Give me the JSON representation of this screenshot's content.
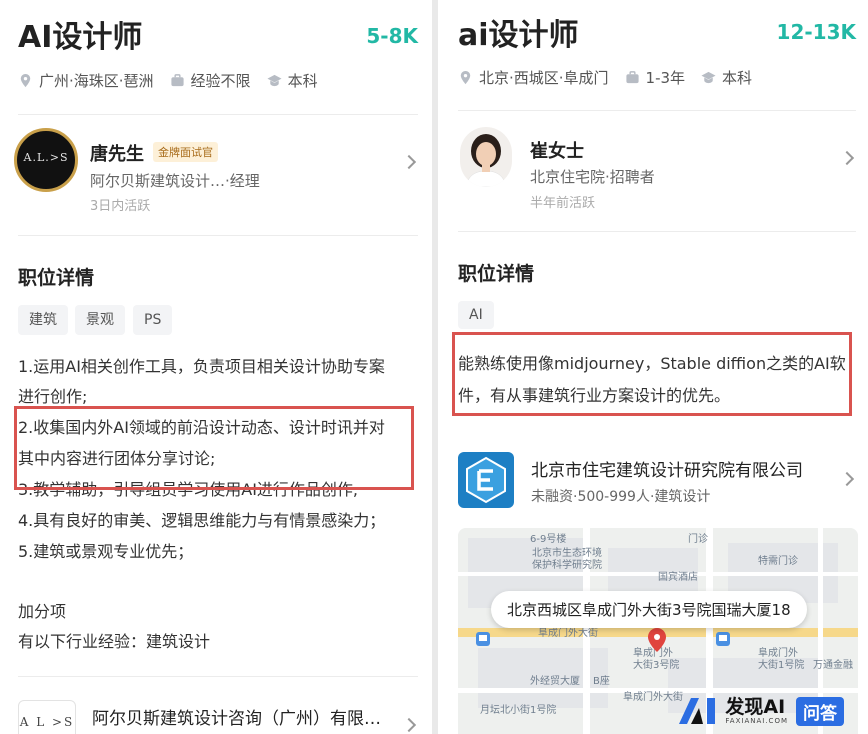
{
  "left": {
    "job_title": "AI设计师",
    "salary": "5-8K",
    "location": "广州·海珠区·琶洲",
    "experience": "经验不限",
    "education": "本科",
    "recruiter": {
      "name": "唐先生",
      "badge": "金牌面试官",
      "company_role": "阿尔贝斯建筑设计…·经理",
      "active": "3日内活跃",
      "avatar_text": "A.L.>S"
    },
    "section_title": "职位详情",
    "tags": [
      "建筑",
      "景观",
      "PS"
    ],
    "desc_lines": [
      "1.运用AI相关创作工具，负责项目相关设计协助专案",
      "进行创作;",
      "2.收集国内外AI领域的前沿设计动态、设计时讯并对",
      "其中内容进行团体分享讨论;",
      "3.教学辅助，引导组员学习使用AI进行作品创作;",
      "4.具有良好的审美、逻辑思维能力与有情景感染力；",
      "5.建筑或景观专业优先；"
    ],
    "bonus_title": "加分项",
    "bonus_text": "有以下行业经验：建筑设计",
    "company_name": "阿尔贝斯建筑设计咨询（广州）有限…",
    "company_logo_text": "A L >S"
  },
  "right": {
    "job_title": "ai设计师",
    "salary": "12-13K",
    "location": "北京·西城区·阜成门",
    "experience": "1-3年",
    "education": "本科",
    "recruiter": {
      "name": "崔女士",
      "company_role": "北京住宅院·招聘者",
      "active": "半年前活跃"
    },
    "section_title": "职位详情",
    "tags": [
      "AI"
    ],
    "desc_lines": [
      "能熟练使用像midjourney，Stable diffion之类的AI软",
      "件，有从事建筑行业方案设计的优先。"
    ],
    "company_name": "北京市住宅建筑设计研究院有限公司",
    "company_sub": "未融资·500-999人·建筑设计",
    "map": {
      "address": "北京西城区阜成门外大街3号院国瑞大厦18",
      "labels": [
        "6-9号楼",
        "北京市生态环境",
        "保护科学研究院",
        "国宾酒店",
        "特需门诊",
        "阜成门外大街",
        "阜成门外",
        "大街3号院",
        "阜成门外",
        "大街1号院",
        "万通金融",
        "外经贸大厦",
        "B座",
        "月坛北小街1号院",
        "阜成门外大街",
        "门诊"
      ]
    },
    "watermark": {
      "brand": "发现AI",
      "sub": "FAXIANAI.COM",
      "badge": "问答"
    }
  },
  "colors": {
    "salary": "#22b8a5",
    "highlight_box": "#d9534f",
    "gold_badge_text": "#a86b1a",
    "gold_badge_bg": "#fdf0d8",
    "company_logo": "#1d7fc4"
  },
  "icons": [
    "location-pin-icon",
    "briefcase-icon",
    "graduation-cap-icon",
    "chevron-right-icon",
    "map-marker-icon",
    "bus-stop-icon"
  ]
}
